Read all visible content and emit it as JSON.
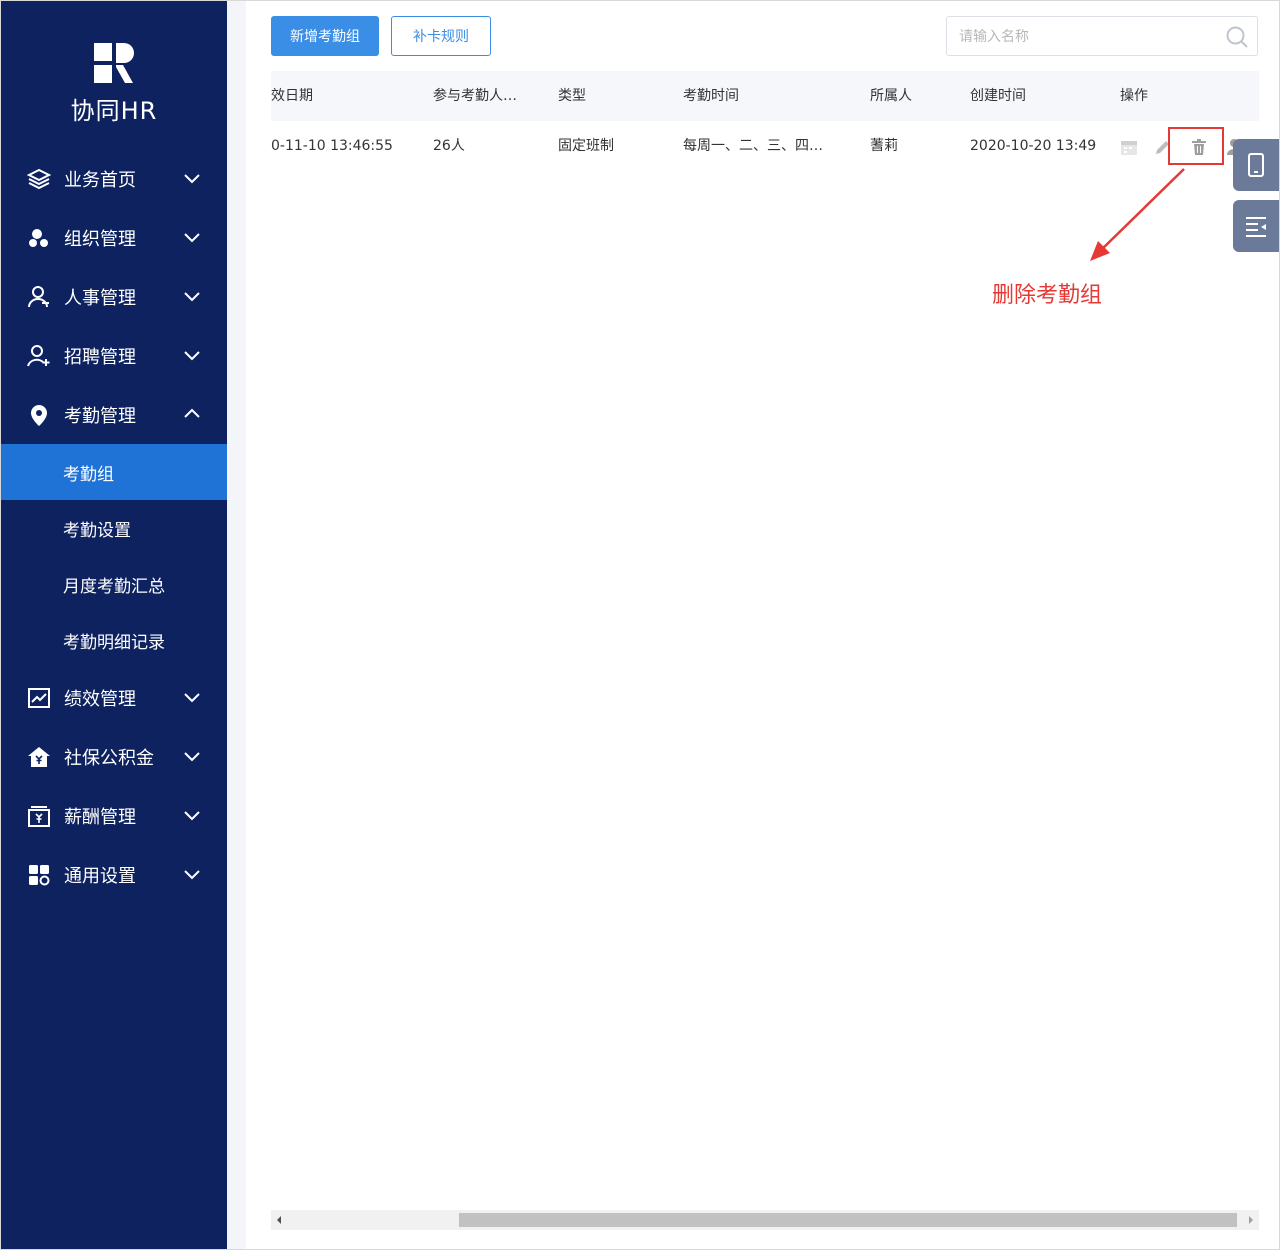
{
  "app": {
    "logo_text": "协同HR"
  },
  "sidebar": {
    "menu": [
      {
        "label": "业务首页",
        "icon": "layers-icon",
        "expanded": false
      },
      {
        "label": "组织管理",
        "icon": "org-icon",
        "expanded": false
      },
      {
        "label": "人事管理",
        "icon": "person-icon",
        "expanded": false
      },
      {
        "label": "招聘管理",
        "icon": "person-add-icon",
        "expanded": false
      },
      {
        "label": "考勤管理",
        "icon": "location-pin-icon",
        "expanded": true
      },
      {
        "label": "绩效管理",
        "icon": "chart-icon",
        "expanded": false
      },
      {
        "label": "社保公积金",
        "icon": "house-yen-icon",
        "expanded": false
      },
      {
        "label": "薪酬管理",
        "icon": "salary-icon",
        "expanded": false
      },
      {
        "label": "通用设置",
        "icon": "grid-icon",
        "expanded": false
      }
    ],
    "attendance_sub": [
      {
        "label": "考勤组",
        "active": true
      },
      {
        "label": "考勤设置",
        "active": false
      },
      {
        "label": "月度考勤汇总",
        "active": false
      },
      {
        "label": "考勤明细记录",
        "active": false
      }
    ]
  },
  "toolbar": {
    "add_label": "新增考勤组",
    "rule_label": "补卡规则",
    "search_placeholder": "请输入名称"
  },
  "table": {
    "headers": [
      "效日期",
      "参与考勤人…",
      "类型",
      "考勤时间",
      "所属人",
      "创建时间",
      "操作"
    ],
    "rows": [
      [
        "0-11-10 13:46:55",
        "26人",
        "固定班制",
        "每周一、二、三、四…",
        "蓍莉",
        "2020-10-20 13:49"
      ]
    ]
  },
  "annotation": {
    "text": "删除考勤组",
    "color": "#e53935"
  },
  "colors": {
    "sidebar": "#0e2260",
    "active": "#1f73d7",
    "primary": "#3a8ee6"
  }
}
